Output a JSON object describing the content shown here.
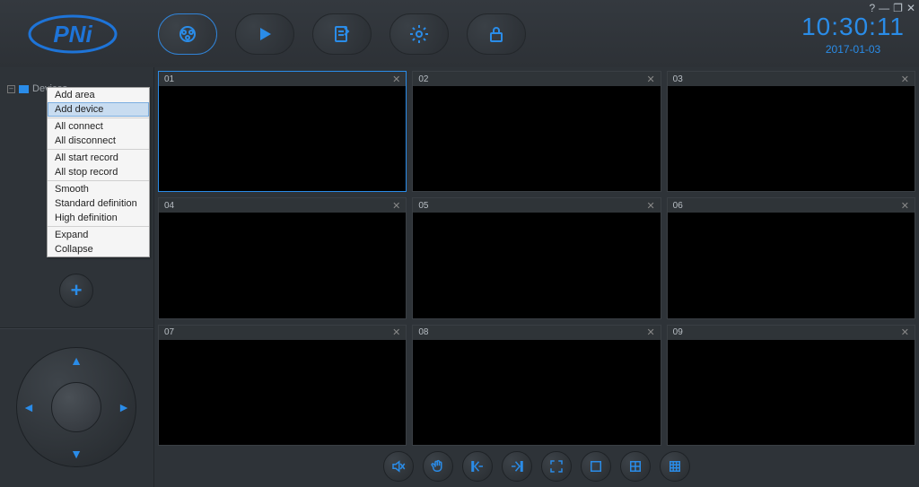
{
  "window_controls": {
    "help": "?",
    "min": "—",
    "restore": "❐",
    "close": "✕"
  },
  "logo": "PNi",
  "clock": {
    "time": "10:30:11",
    "date": "2017-01-03"
  },
  "sidebar": {
    "tree_root": "Devices",
    "context_menu": [
      {
        "label": "Add area",
        "sel": false
      },
      {
        "label": "Add device",
        "sel": true
      },
      {
        "sep": true
      },
      {
        "label": "All connect",
        "sel": false
      },
      {
        "label": "All disconnect",
        "sel": false
      },
      {
        "sep": true
      },
      {
        "label": "All start record",
        "sel": false
      },
      {
        "label": "All stop record",
        "sel": false
      },
      {
        "sep": true
      },
      {
        "label": "Smooth",
        "sel": false
      },
      {
        "label": "Standard definition",
        "sel": false
      },
      {
        "label": "High definition",
        "sel": false
      },
      {
        "sep": true
      },
      {
        "label": "Expand",
        "sel": false
      },
      {
        "label": "Collapse",
        "sel": false
      }
    ]
  },
  "tiles": [
    {
      "label": "01",
      "selected": true
    },
    {
      "label": "02",
      "selected": false
    },
    {
      "label": "03",
      "selected": false
    },
    {
      "label": "04",
      "selected": false
    },
    {
      "label": "05",
      "selected": false
    },
    {
      "label": "06",
      "selected": false
    },
    {
      "label": "07",
      "selected": false
    },
    {
      "label": "08",
      "selected": false
    },
    {
      "label": "09",
      "selected": false
    }
  ],
  "icons": {
    "close_x": "✕",
    "plus": "+",
    "arrows": {
      "up": "▲",
      "down": "▼",
      "left": "◄",
      "right": "►"
    }
  }
}
